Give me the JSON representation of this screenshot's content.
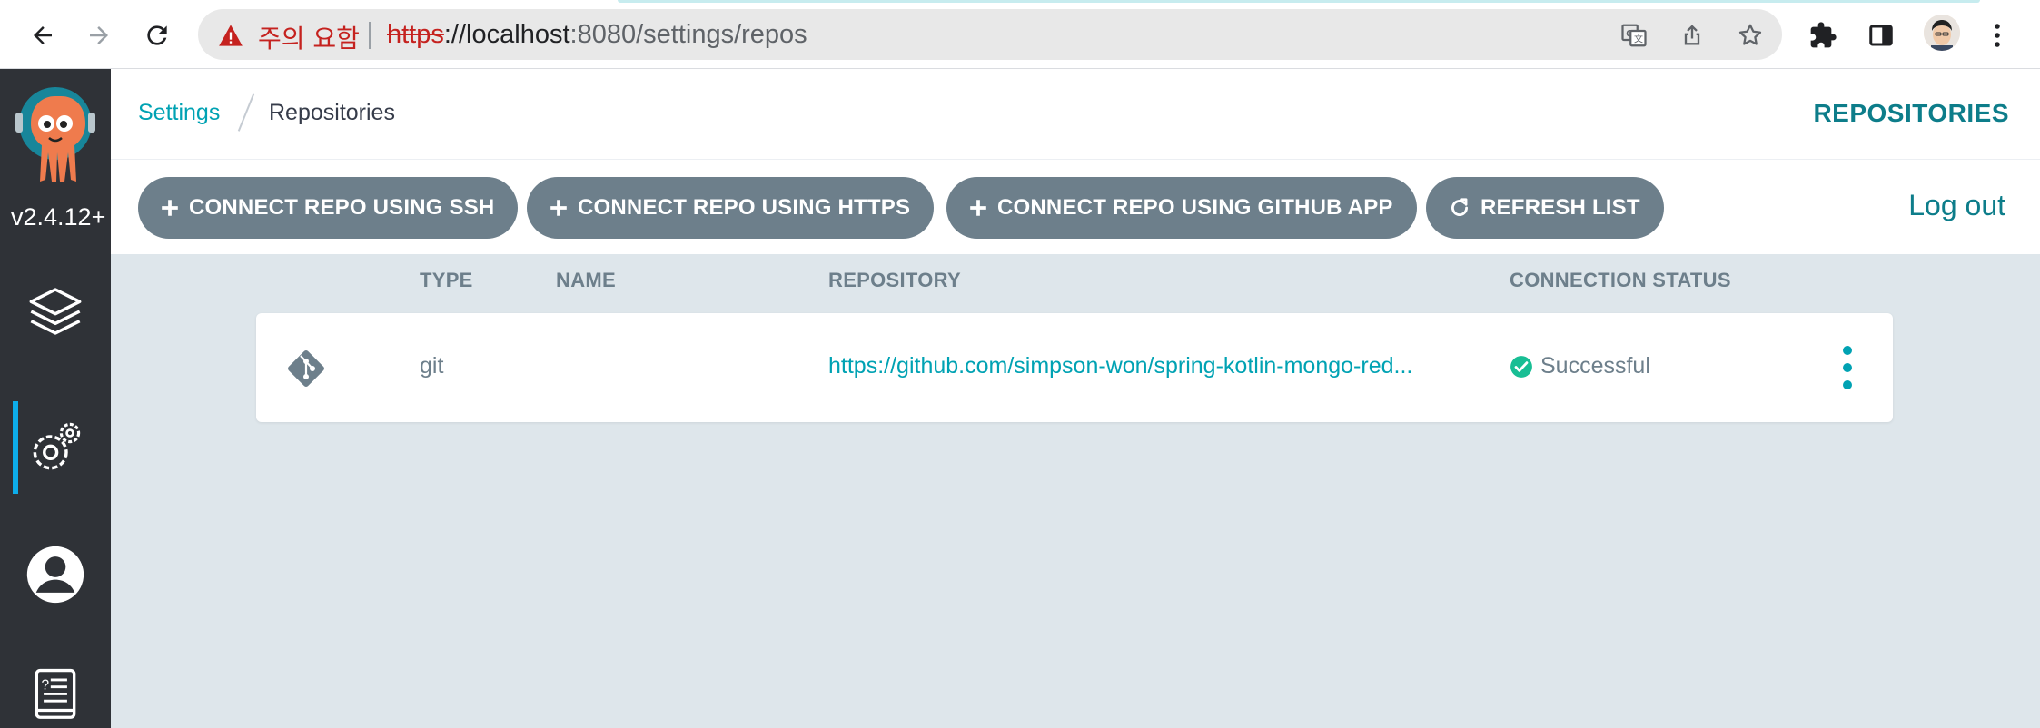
{
  "browser": {
    "security_label": "주의 요함",
    "url_scheme": "https",
    "url_host": "://localhost",
    "url_rest": ":8080/settings/repos"
  },
  "sidebar": {
    "version": "v2.4.12+",
    "items": [
      {
        "name": "applications",
        "icon": "layers-icon"
      },
      {
        "name": "settings",
        "icon": "gear-icon",
        "active": true
      },
      {
        "name": "user-info",
        "icon": "user-circle-icon"
      },
      {
        "name": "documentation",
        "icon": "book-icon"
      }
    ]
  },
  "breadcrumb": {
    "parent": "Settings",
    "current": "Repositories"
  },
  "page_heading": "REPOSITORIES",
  "toolbar": {
    "buttons": [
      {
        "label": "CONNECT REPO USING SSH",
        "icon": "plus-icon"
      },
      {
        "label": "CONNECT REPO USING HTTPS",
        "icon": "plus-icon"
      },
      {
        "label": "CONNECT REPO USING GITHUB APP",
        "icon": "plus-icon"
      },
      {
        "label": "REFRESH LIST",
        "icon": "refresh-icon"
      }
    ],
    "logout": "Log out"
  },
  "table": {
    "headers": {
      "type": "TYPE",
      "name": "NAME",
      "repository": "REPOSITORY",
      "status": "CONNECTION STATUS"
    },
    "rows": [
      {
        "type": "git",
        "name": "",
        "repository": "https://github.com/simpson-won/spring-kotlin-mongo-red...",
        "status": "Successful"
      }
    ]
  },
  "colors": {
    "accent": "#00a2b3",
    "button": "#6d7f8b",
    "sidebar": "#2f3237",
    "content_bg": "#dee6eb",
    "success": "#18be94"
  }
}
